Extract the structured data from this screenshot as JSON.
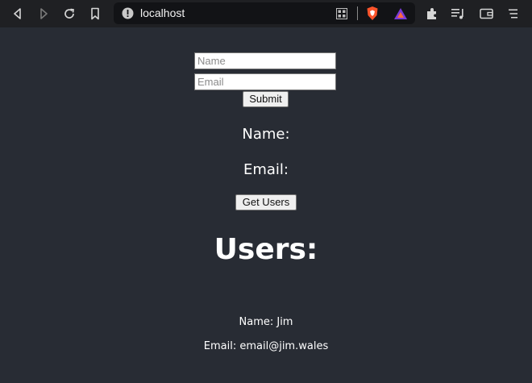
{
  "browser": {
    "url": "localhost"
  },
  "form": {
    "name_placeholder": "Name",
    "email_placeholder": "Email",
    "submit_label": "Submit"
  },
  "preview": {
    "name_label": "Name:",
    "email_label": "Email:"
  },
  "actions": {
    "get_users_label": "Get Users"
  },
  "users": {
    "heading": "Users:",
    "items": [
      {
        "name_line": "Name: Jim",
        "email_line": "Email: email@jim.wales"
      }
    ]
  },
  "colors": {
    "page_background": "#282c34",
    "toolbar_background": "#1f2023",
    "urlbar_background": "#121316",
    "text": "#ffffff"
  }
}
